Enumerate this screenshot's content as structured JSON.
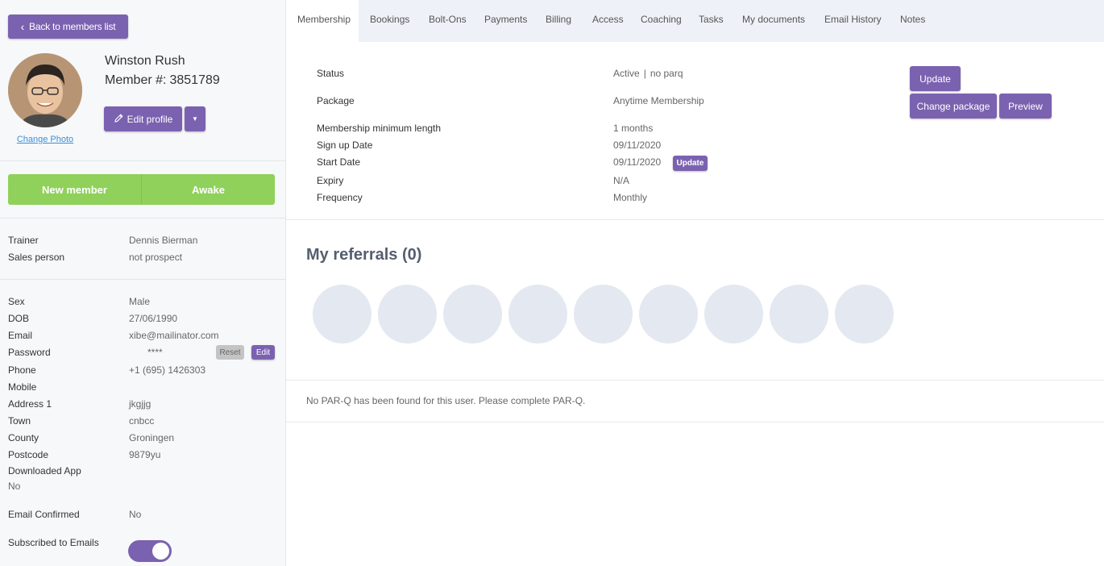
{
  "sidebar": {
    "back_label": "Back to members list",
    "name": "Winston Rush",
    "member_number_label": "Member #:",
    "member_number": "3851789",
    "change_photo": "Change Photo",
    "edit_profile": "Edit profile",
    "status_left": "New member",
    "status_right": "Awake",
    "trainer_label": "Trainer",
    "trainer": "Dennis Bierman",
    "sales_label": "Sales person",
    "sales": "not prospect",
    "details": [
      {
        "label": "Sex",
        "value": "Male"
      },
      {
        "label": "DOB",
        "value": "27/06/1990"
      },
      {
        "label": "Email",
        "value": "xibe@mailinator.com"
      },
      {
        "label": "Password",
        "value": "****"
      },
      {
        "label": "Phone",
        "value": "+1 (695) 1426303"
      },
      {
        "label": "Mobile",
        "value": ""
      },
      {
        "label": "Address 1",
        "value": "jkgjjg"
      },
      {
        "label": "Town",
        "value": "cnbcc"
      },
      {
        "label": "County",
        "value": "Groningen"
      },
      {
        "label": "Postcode",
        "value": "9879yu"
      }
    ],
    "downloaded_label": "Downloaded App",
    "downloaded": "No",
    "email_confirmed_label": "Email Confirmed",
    "email_confirmed": "No",
    "subscribed_label": "Subscribed to Emails",
    "subscribed": true,
    "reset_label": "Reset",
    "edit_label": "Edit"
  },
  "tabs": [
    {
      "label": "Membership",
      "active": true
    },
    {
      "label": "Bookings"
    },
    {
      "label": "Bolt-Ons"
    },
    {
      "label": "Payments"
    },
    {
      "label": "Billing"
    },
    {
      "label": "Access"
    },
    {
      "label": "Coaching"
    },
    {
      "label": "Tasks"
    },
    {
      "label": "My documents"
    },
    {
      "label": "Email History"
    },
    {
      "label": "Notes"
    }
  ],
  "membership": {
    "status_label": "Status",
    "status": "Active",
    "status_sep": "|",
    "parq": "no parq",
    "package_label": "Package",
    "package": "Anytime Membership",
    "min_length_label": "Membership minimum length",
    "min_length": "1 months",
    "signup_label": "Sign up Date",
    "signup": "09/11/2020",
    "start_label": "Start Date",
    "start": "09/11/2020",
    "expiry_label": "Expiry",
    "expiry": "N/A",
    "frequency_label": "Frequency",
    "frequency": "Monthly",
    "update_label": "Update",
    "change_package_label": "Change package",
    "preview_label": "Preview",
    "start_update_label": "Update"
  },
  "referrals": {
    "title": "My referrals (0)",
    "slots": 9
  },
  "parq_message": "No PAR-Q has been found for this user. Please complete PAR-Q.",
  "colors": {
    "accent": "#7b62b0",
    "status_green": "#8fd15b",
    "link": "#3a8fd6"
  }
}
